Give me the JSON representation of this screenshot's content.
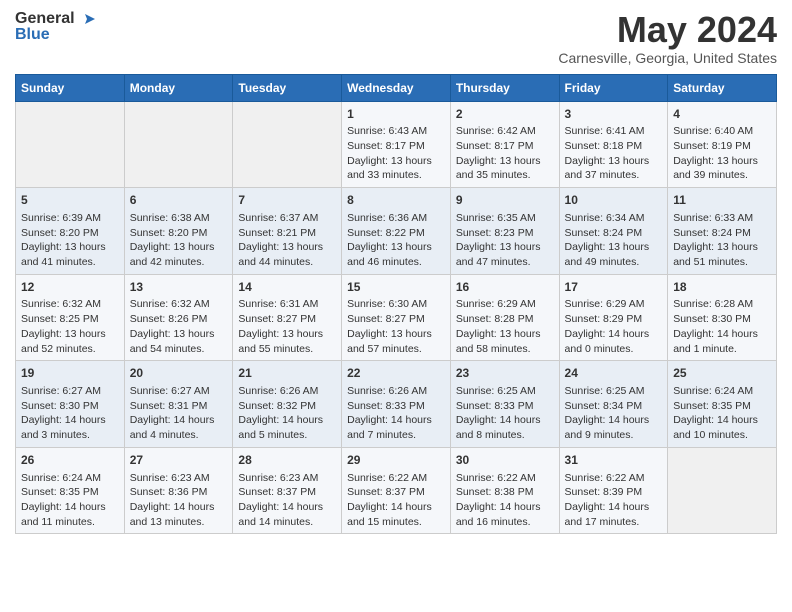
{
  "header": {
    "logo_general": "General",
    "logo_blue": "Blue",
    "title": "May 2024",
    "subtitle": "Carnesville, Georgia, United States"
  },
  "days_of_week": [
    "Sunday",
    "Monday",
    "Tuesday",
    "Wednesday",
    "Thursday",
    "Friday",
    "Saturday"
  ],
  "weeks": [
    [
      {
        "day": "",
        "content": ""
      },
      {
        "day": "",
        "content": ""
      },
      {
        "day": "",
        "content": ""
      },
      {
        "day": "1",
        "content": "Sunrise: 6:43 AM\nSunset: 8:17 PM\nDaylight: 13 hours\nand 33 minutes."
      },
      {
        "day": "2",
        "content": "Sunrise: 6:42 AM\nSunset: 8:17 PM\nDaylight: 13 hours\nand 35 minutes."
      },
      {
        "day": "3",
        "content": "Sunrise: 6:41 AM\nSunset: 8:18 PM\nDaylight: 13 hours\nand 37 minutes."
      },
      {
        "day": "4",
        "content": "Sunrise: 6:40 AM\nSunset: 8:19 PM\nDaylight: 13 hours\nand 39 minutes."
      }
    ],
    [
      {
        "day": "5",
        "content": "Sunrise: 6:39 AM\nSunset: 8:20 PM\nDaylight: 13 hours\nand 41 minutes."
      },
      {
        "day": "6",
        "content": "Sunrise: 6:38 AM\nSunset: 8:20 PM\nDaylight: 13 hours\nand 42 minutes."
      },
      {
        "day": "7",
        "content": "Sunrise: 6:37 AM\nSunset: 8:21 PM\nDaylight: 13 hours\nand 44 minutes."
      },
      {
        "day": "8",
        "content": "Sunrise: 6:36 AM\nSunset: 8:22 PM\nDaylight: 13 hours\nand 46 minutes."
      },
      {
        "day": "9",
        "content": "Sunrise: 6:35 AM\nSunset: 8:23 PM\nDaylight: 13 hours\nand 47 minutes."
      },
      {
        "day": "10",
        "content": "Sunrise: 6:34 AM\nSunset: 8:24 PM\nDaylight: 13 hours\nand 49 minutes."
      },
      {
        "day": "11",
        "content": "Sunrise: 6:33 AM\nSunset: 8:24 PM\nDaylight: 13 hours\nand 51 minutes."
      }
    ],
    [
      {
        "day": "12",
        "content": "Sunrise: 6:32 AM\nSunset: 8:25 PM\nDaylight: 13 hours\nand 52 minutes."
      },
      {
        "day": "13",
        "content": "Sunrise: 6:32 AM\nSunset: 8:26 PM\nDaylight: 13 hours\nand 54 minutes."
      },
      {
        "day": "14",
        "content": "Sunrise: 6:31 AM\nSunset: 8:27 PM\nDaylight: 13 hours\nand 55 minutes."
      },
      {
        "day": "15",
        "content": "Sunrise: 6:30 AM\nSunset: 8:27 PM\nDaylight: 13 hours\nand 57 minutes."
      },
      {
        "day": "16",
        "content": "Sunrise: 6:29 AM\nSunset: 8:28 PM\nDaylight: 13 hours\nand 58 minutes."
      },
      {
        "day": "17",
        "content": "Sunrise: 6:29 AM\nSunset: 8:29 PM\nDaylight: 14 hours\nand 0 minutes."
      },
      {
        "day": "18",
        "content": "Sunrise: 6:28 AM\nSunset: 8:30 PM\nDaylight: 14 hours\nand 1 minute."
      }
    ],
    [
      {
        "day": "19",
        "content": "Sunrise: 6:27 AM\nSunset: 8:30 PM\nDaylight: 14 hours\nand 3 minutes."
      },
      {
        "day": "20",
        "content": "Sunrise: 6:27 AM\nSunset: 8:31 PM\nDaylight: 14 hours\nand 4 minutes."
      },
      {
        "day": "21",
        "content": "Sunrise: 6:26 AM\nSunset: 8:32 PM\nDaylight: 14 hours\nand 5 minutes."
      },
      {
        "day": "22",
        "content": "Sunrise: 6:26 AM\nSunset: 8:33 PM\nDaylight: 14 hours\nand 7 minutes."
      },
      {
        "day": "23",
        "content": "Sunrise: 6:25 AM\nSunset: 8:33 PM\nDaylight: 14 hours\nand 8 minutes."
      },
      {
        "day": "24",
        "content": "Sunrise: 6:25 AM\nSunset: 8:34 PM\nDaylight: 14 hours\nand 9 minutes."
      },
      {
        "day": "25",
        "content": "Sunrise: 6:24 AM\nSunset: 8:35 PM\nDaylight: 14 hours\nand 10 minutes."
      }
    ],
    [
      {
        "day": "26",
        "content": "Sunrise: 6:24 AM\nSunset: 8:35 PM\nDaylight: 14 hours\nand 11 minutes."
      },
      {
        "day": "27",
        "content": "Sunrise: 6:23 AM\nSunset: 8:36 PM\nDaylight: 14 hours\nand 13 minutes."
      },
      {
        "day": "28",
        "content": "Sunrise: 6:23 AM\nSunset: 8:37 PM\nDaylight: 14 hours\nand 14 minutes."
      },
      {
        "day": "29",
        "content": "Sunrise: 6:22 AM\nSunset: 8:37 PM\nDaylight: 14 hours\nand 15 minutes."
      },
      {
        "day": "30",
        "content": "Sunrise: 6:22 AM\nSunset: 8:38 PM\nDaylight: 14 hours\nand 16 minutes."
      },
      {
        "day": "31",
        "content": "Sunrise: 6:22 AM\nSunset: 8:39 PM\nDaylight: 14 hours\nand 17 minutes."
      },
      {
        "day": "",
        "content": ""
      }
    ]
  ]
}
